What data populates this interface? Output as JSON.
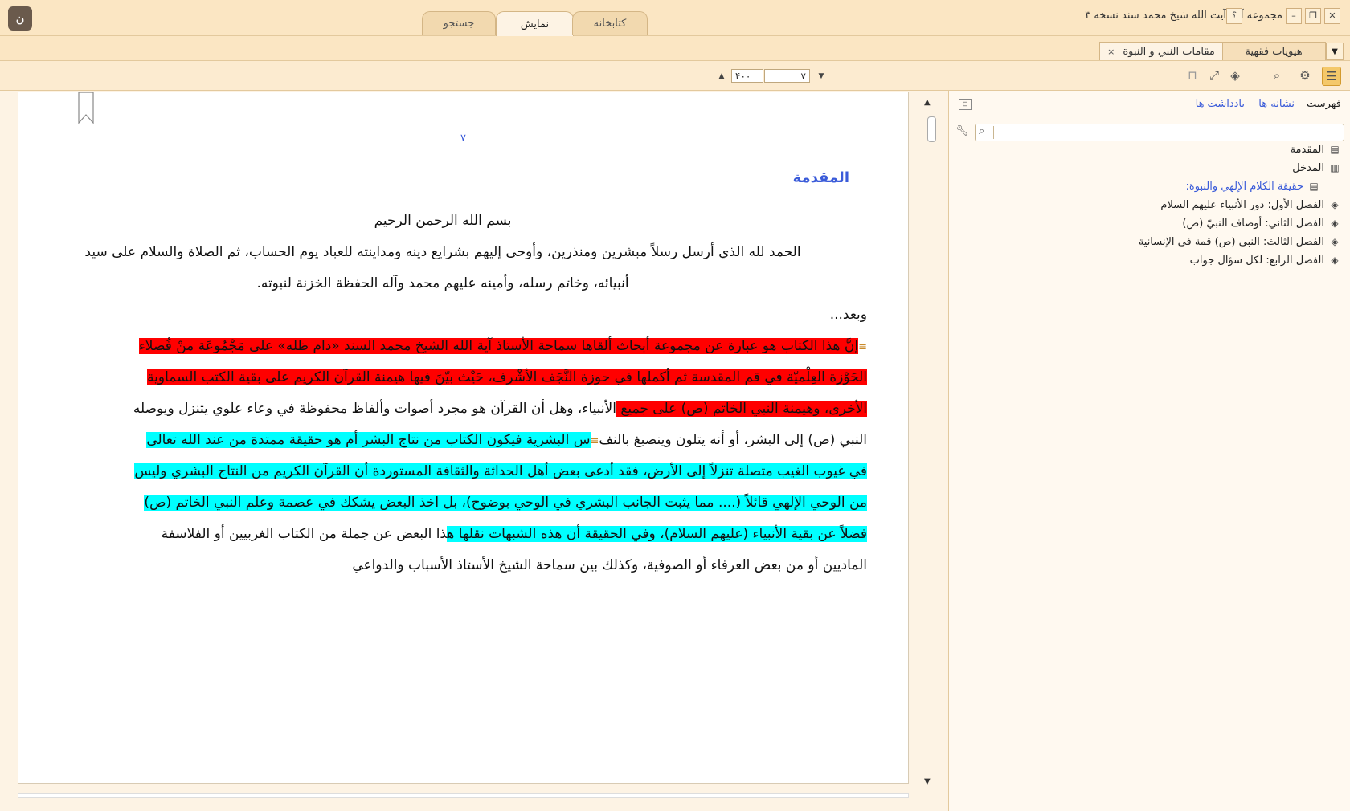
{
  "window": {
    "title": "مجموعه آثار آیت الله شیخ محمد سند نسخه ۳",
    "help": "؟",
    "minimize": "–",
    "restore": "❐",
    "close": "✕"
  },
  "main_tabs": [
    {
      "label": "کتابخانه"
    },
    {
      "label": "نمایش"
    },
    {
      "label": "جستجو"
    }
  ],
  "doc_tabs": [
    {
      "label": "هيويات فقهية"
    },
    {
      "label": "مقامات النبي و النبوة",
      "close": "×"
    }
  ],
  "toolbar": {
    "page_current": "٧",
    "page_total": "۴۰۰"
  },
  "sidebar": {
    "tabs": [
      "فهرست",
      "نشانه ها",
      "یادداشت ها"
    ],
    "search_placeholder": "",
    "toc": [
      {
        "label": "المقدمة",
        "icon": "page-icon"
      },
      {
        "label": "المدخل",
        "icon": "book-open-icon"
      },
      {
        "label": "حقيقة الكلام الإلهي والنبوة:",
        "icon": "page-icon",
        "selected": true
      },
      {
        "label": "الفصل الأول: دور الأنبياء عليهم السلام",
        "icon": "book-icon"
      },
      {
        "label": "الفصل الثاني: أوصاف النبيّ (ص)",
        "icon": "book-icon"
      },
      {
        "label": "الفصل الثالث: النبي (ص) قمة في الإنسانية",
        "icon": "book-icon"
      },
      {
        "label": "الفصل الرابع: لكل سؤال جواب",
        "icon": "book-icon"
      }
    ]
  },
  "document": {
    "page_number": "٧",
    "heading": "المقدمة",
    "lines": [
      {
        "text": "بسم الله الرحمن الرحيم"
      },
      {
        "text": "الحمد لله الذي أرسل رسلاً مبشرين ومنذرين، وأوحى إليهم بشرايع دينه ومداينته للعباد يوم الحساب، ثم الصلاة والسلام على سيد"
      },
      {
        "text": "أنبيائه، وخاتم رسله، وأمينه عليهم محمد وآله الحفظة الخزنة لنبوته."
      },
      {
        "text": "وبعد..."
      },
      {
        "text": "إنَّ هذا الكتاب هو عبارة عن مجموعة أبحاث ألقاها سماحة الأستاذ آية الله الشيخ محمد السند «دام ظله» على مَجْمُوعَة منْ فُضلاء"
      },
      {
        "text": "الحَوْزة العِلْميّة في قم المقدسة ثم أكملها في حوزة النَّجَف الأشْرف، حَيْث بيّنَ فيها هيمنة القرآن الكريم على بقية الكتب السماوية"
      },
      {
        "a": "الأخرى، وهيمنة النبي الخاتم (ص) على جميع ",
        "b": "الأنبياء، وهل أن القرآن هو مجرد أصوات وألفاظ محفوظة في وعاء علوي يتنزل ويوصله"
      },
      {
        "a": "النبي (ص) إلى البشر، أو أنه يتلون وينصبغ بالنف",
        "b": "س البشرية فيكون الكتاب من نتاج البشر أم هو حقيقة ممتدة من عند الله تعالى"
      },
      {
        "text": "في غيوب الغيب متصلة تنزلاً إلى الأرض، فقد أدعى بعض أهل الحداثة والثقافة المستوردة أن القرآن الكريم من النتاج البشري وليس"
      },
      {
        "text": "من الوحي الإلهي قائلاً (.... مما يثبت الجانب البشري في الوحي بوضوح)، بل اخذ البعض يشكك في عصمة وعلم النبي الخاتم (ص)"
      },
      {
        "a": "فضلاً عن بقية الأنبياء (عليهم السلام)، وفي الحقيقة أن هذه الشبهات نقلها ه",
        "b": "ذا البعض عن جملة من الكتاب الغربيين أو الفلاسفة"
      },
      {
        "text": "الماديين أو من بعض العرفاء أو الصوفية، وكذلك بين سماحة الشيخ الأستاذ الأسباب والدواعي"
      }
    ]
  },
  "colors": {
    "highlight_red": "#ff0000",
    "highlight_cyan": "#00ffff",
    "link_blue": "#3a5bd9",
    "accent": "#f4c86a"
  }
}
